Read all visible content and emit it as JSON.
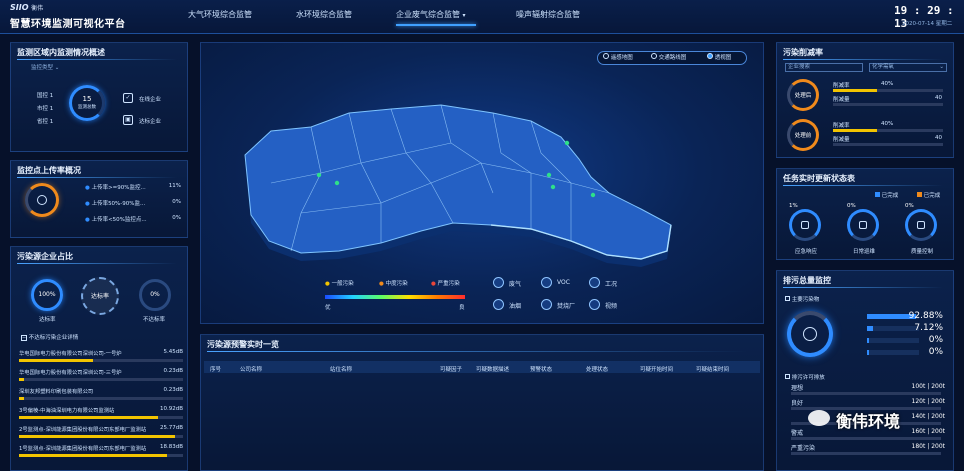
{
  "header": {
    "logo_text": "SIIO",
    "brand": "衡伟",
    "title": "智慧环境监测可视化平台",
    "tabs": [
      {
        "label": "大气环境综合监管"
      },
      {
        "label": "水环境综合监管"
      },
      {
        "label": "企业废气综合监管",
        "active": true
      },
      {
        "label": "噪声辐射综合监管"
      }
    ],
    "time": "19 : 29 : 13",
    "date": "2020-07-14 星期二"
  },
  "overview": {
    "title": "监测区域内监测情况概述",
    "dropdown": "监控类型",
    "stats": [
      {
        "label": "国控",
        "value": "1"
      },
      {
        "label": "市控",
        "value": "1"
      },
      {
        "label": "省控",
        "value": "1"
      }
    ],
    "ring_value": "15",
    "ring_label": "监测总数",
    "online_label": "在线企业",
    "standard_label": "达标企业"
  },
  "upload": {
    "title": "监控点上传率概况",
    "rows": [
      {
        "label": "上传率>=90%监控...",
        "value": "11%"
      },
      {
        "label": "上传率50%-90%监...",
        "value": "0%"
      },
      {
        "label": "上传率<50%监控点...",
        "value": "0%"
      }
    ]
  },
  "pollution_source": {
    "title": "污染源企业占比",
    "rings": [
      {
        "value": "100%",
        "label": "达标率"
      },
      {
        "value": "达标率",
        "label": ""
      },
      {
        "value": "0%",
        "label": "不达标率"
      }
    ],
    "list_header": "不达标污染企业详情",
    "items": [
      {
        "name": "华电国际电力股份有限公司深圳公司-一号炉",
        "value": "5.45dB",
        "fill": 0.45
      },
      {
        "name": "华电国际电力股份有限公司深圳公司-三号炉",
        "value": "0.23dB",
        "fill": 0.03
      },
      {
        "name": "深圳友邦塑料印刷包装有限公司",
        "value": "0.23dB",
        "fill": 0.03
      },
      {
        "name": "3号偏棱-中海油深圳电力有限公司监测站",
        "value": "10.92dB",
        "fill": 0.85
      },
      {
        "name": "2号监测点-深圳能源集团股份有限公司东部电厂监测站",
        "value": "25.77dB",
        "fill": 0.95
      },
      {
        "name": "1号监测点-深圳能源集团股份有限公司东部电厂监测站",
        "value": "18.83dB",
        "fill": 0.9
      }
    ]
  },
  "map": {
    "legend_options": [
      {
        "label": "遥感地图",
        "selected": false
      },
      {
        "label": "交通路线图",
        "selected": false
      },
      {
        "label": "透视图",
        "selected": true
      }
    ],
    "levels": [
      {
        "label": "一般污染",
        "color": "#f2c400"
      },
      {
        "label": "中度污染",
        "color": "#f08a1c"
      },
      {
        "label": "严重污染",
        "color": "#e8463a"
      }
    ],
    "gradient_low": "优",
    "gradient_high": "良",
    "categories": [
      {
        "label": "废气",
        "icon": "smoke-icon"
      },
      {
        "label": "VOC",
        "icon": "voc-icon"
      },
      {
        "label": "工况",
        "icon": "gauge-icon"
      },
      {
        "label": "油烟",
        "icon": "oil-fume-icon"
      },
      {
        "label": "焚烧厂",
        "icon": "incinerator-icon"
      },
      {
        "label": "视频",
        "icon": "video-icon"
      }
    ]
  },
  "alerts": {
    "title": "污染源预警实时一览",
    "columns": [
      "序号",
      "公司名称",
      "站位名称",
      "可疑因子",
      "可疑数据描述",
      "预警状态",
      "处理状态",
      "可疑开始时间",
      "可疑结束时间"
    ]
  },
  "reduction": {
    "title": "污染削减率",
    "filter1": "企业搜索",
    "filter2": "化学需氧",
    "rows": [
      {
        "ring": "处理后",
        "rate_label": "削减率",
        "rate": "40%",
        "amt_label": "削减量",
        "amt": "40",
        "fill": 0.4
      },
      {
        "ring": "处理前",
        "rate_label": "削减率",
        "rate": "40%",
        "amt_label": "削减量",
        "amt": "40",
        "fill": 0.4
      }
    ]
  },
  "tasks": {
    "title": "任务实时更新状态表",
    "legend": [
      {
        "label": "已完成",
        "color": "#2f8cff"
      },
      {
        "label": "已完成",
        "color": "#f08a1c"
      }
    ],
    "items": [
      {
        "value": "1%",
        "label": "应急响应"
      },
      {
        "value": "0%",
        "label": "日常巡维"
      },
      {
        "value": "0%",
        "label": "质量控制"
      }
    ]
  },
  "emission": {
    "title": "排污总量监控",
    "sub1": "主要污染物",
    "pct_rows": [
      {
        "value": "92.88%",
        "fill": 0.93
      },
      {
        "value": "7.12%",
        "fill": 0.07
      },
      {
        "value": "0%",
        "fill": 0
      },
      {
        "value": "0%",
        "fill": 0
      }
    ],
    "sub2": "排污许可排放",
    "permit_rows": [
      {
        "label": "理想",
        "value": "100t | 200t"
      },
      {
        "label": "良好",
        "value": "120t | 200t"
      },
      {
        "label": "",
        "value": "140t | 200t"
      },
      {
        "label": "警戒",
        "value": "160t | 200t"
      },
      {
        "label": "严重污染",
        "value": "180t | 200t"
      }
    ]
  },
  "watermark": "衡伟环境"
}
